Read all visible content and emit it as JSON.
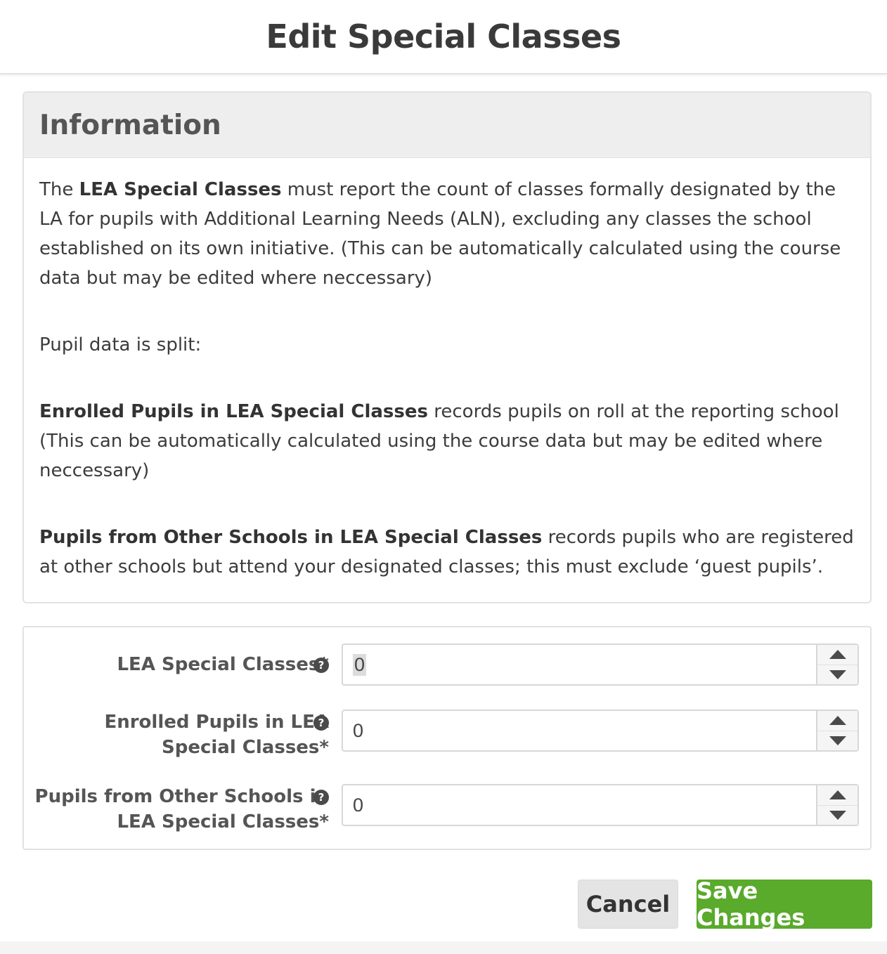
{
  "modal": {
    "title": "Edit Special Classes"
  },
  "info": {
    "heading": "Information",
    "p1": {
      "a": "The ",
      "b": "LEA Special Classes",
      "c": " must report the count of classes formally designated by the LA for pupils with Additional Learning Needs (ALN), excluding any classes the school established on its own initiative. (This can be automatically calculated using the course data but may be edited where neccessary)"
    },
    "p2": "Pupil data is split:",
    "p3": {
      "b": "Enrolled Pupils in LEA Special Classes",
      "c": " records pupils on roll at the reporting school (This can be automatically calculated using the course data but may be edited where neccessary)"
    },
    "p4": {
      "b": "Pupils from Other Schools in LEA Special Classes",
      "c": " records pupils who are registered at other schools but attend your designated classes; this must exclude ‘guest pupils’."
    }
  },
  "form": {
    "fields": [
      {
        "label": "LEA Special Classes*",
        "value": "0",
        "help_icon": "question-circle-icon"
      },
      {
        "label_line1": "Enrolled Pupils in LEA",
        "label_line2": "Special Classes*",
        "value": "0",
        "help_icon": "question-circle-icon"
      },
      {
        "label_line1": "Pupils from Other Schools in",
        "label_line2": "LEA Special Classes*",
        "value": "0",
        "help_icon": "question-circle-icon"
      }
    ]
  },
  "footer": {
    "cancel_label": "Cancel",
    "save_label": "Save Changes"
  },
  "colors": {
    "save": "#5aaa2c",
    "cancel": "#e4e4e4",
    "info_header": "#eeeeee"
  }
}
